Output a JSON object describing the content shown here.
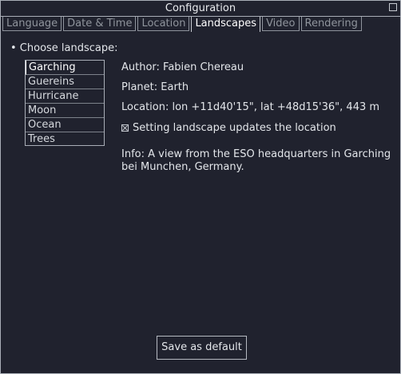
{
  "window": {
    "title": "Configuration"
  },
  "tabs": [
    {
      "label": "Language",
      "active": false
    },
    {
      "label": "Date & Time",
      "active": false
    },
    {
      "label": "Location",
      "active": false
    },
    {
      "label": "Landscapes",
      "active": true
    },
    {
      "label": "Video",
      "active": false
    },
    {
      "label": "Rendering",
      "active": false
    }
  ],
  "landscapes": {
    "section_title": "• Choose landscape:",
    "items": [
      "Garching",
      "Guereins",
      "Hurricane",
      "Moon",
      "Ocean",
      "Trees"
    ],
    "selected": "Garching"
  },
  "details": {
    "author": "Author: Fabien Chereau",
    "planet": "Planet: Earth",
    "location": "Location: lon +11d40'15\", lat +48d15'36\", 443 m",
    "update_location_label": "Setting landscape updates the location",
    "update_location_checked": true,
    "info": "Info: A view from the ESO headquarters in Garching bei Munchen, Germany."
  },
  "footer": {
    "save_label": "Save as default"
  },
  "colors": {
    "background": "#20222e",
    "border": "#a9aeb7",
    "text": "#e3e6ea",
    "inactive_tab_text": "#8f949c"
  }
}
